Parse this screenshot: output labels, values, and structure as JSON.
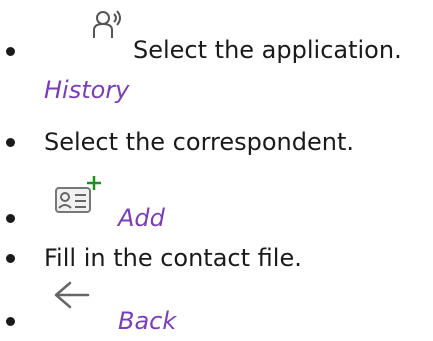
{
  "steps": [
    {
      "icon": "contactless-user-icon",
      "text": "Select the application.",
      "link": "History"
    },
    {
      "text": "Select the correspondent."
    },
    {
      "icon": "add-contact-card-icon",
      "link": "Add"
    },
    {
      "text": "Fill in the contact file."
    },
    {
      "icon": "back-arrow-icon",
      "link": "Back"
    }
  ],
  "colors": {
    "text": "#1a1a1a",
    "link": "#7a3fb5"
  }
}
